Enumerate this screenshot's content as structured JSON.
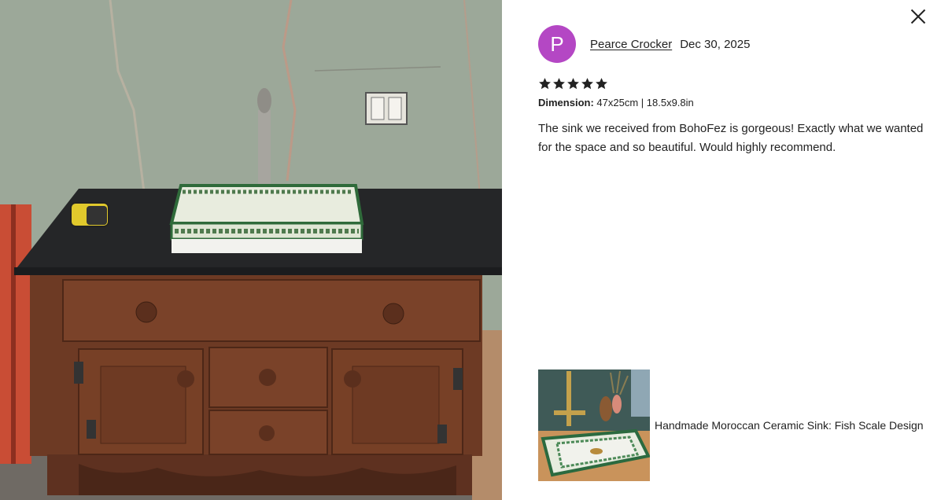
{
  "review": {
    "reviewer_initial": "P",
    "reviewer_name": "Pearce Crocker",
    "date": "Dec 30, 2025",
    "rating": 5,
    "dimension_label": "Dimension:",
    "dimension_value": "47x25cm | 18.5x9.8in",
    "text": "The sink we received from BohoFez is gorgeous! Exactly what we wanted for the space and so beautiful. Would highly recommend."
  },
  "product": {
    "title": "Handmade Moroccan Ceramic Sink: Fish Scale Design"
  },
  "icons": {
    "close": "close-icon",
    "star": "star-icon"
  },
  "colors": {
    "avatar_bg": "#b447c4",
    "text": "#222222",
    "star": "#222222"
  }
}
